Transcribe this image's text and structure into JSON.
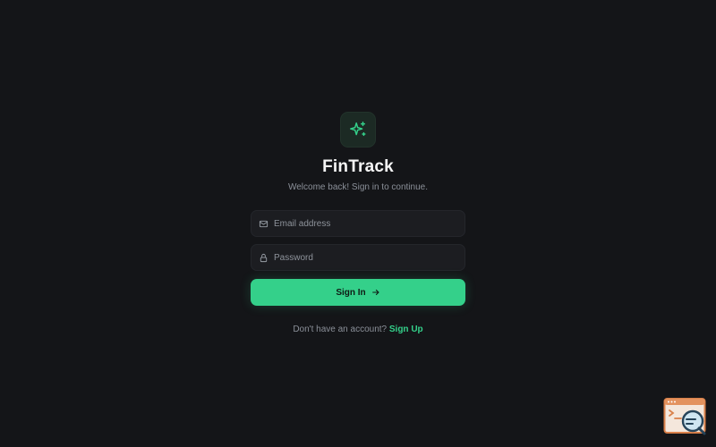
{
  "app": {
    "name": "FinTrack",
    "subtitle": "Welcome back! Sign in to continue.",
    "logo_icon": "sparkles-icon"
  },
  "form": {
    "email": {
      "placeholder": "Email address",
      "value": "",
      "icon": "mail-icon"
    },
    "password": {
      "placeholder": "Password",
      "value": "",
      "icon": "lock-icon"
    },
    "submit_label": "Sign In",
    "submit_icon": "arrow-right-icon"
  },
  "footer": {
    "prompt": "Don't have an account?",
    "link_label": "Sign Up"
  },
  "colors": {
    "background": "#141518",
    "accent": "#34d08a",
    "field_bg": "#1c1d21",
    "muted_text": "#8b9099"
  }
}
